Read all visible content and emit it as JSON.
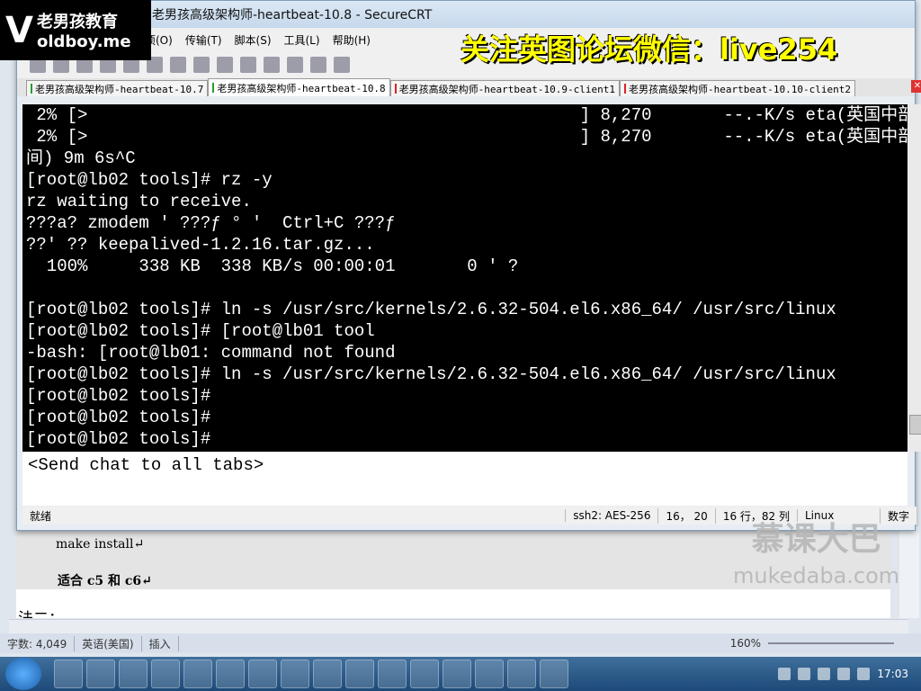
{
  "window_title": "老男孩高级架构师-heartbeat-10.8 - SecureCRT",
  "logo": {
    "cn": "老男孩教育",
    "en": "oldboy.me"
  },
  "watermark_top": "关注英图论坛微信：live254",
  "watermark_bottom": {
    "cn": "慕课大巴",
    "en": "mukedaba.com"
  },
  "menu": [
    "选项(O)",
    "传输(T)",
    "脚本(S)",
    "工具(L)",
    "帮助(H)"
  ],
  "tabs": [
    {
      "label": "老男孩高级架构师-heartbeat-10.7",
      "status_color": "#2a9d2a"
    },
    {
      "label": "老男孩高级架构师-heartbeat-10.8",
      "status_color": "#2a9d2a",
      "active": true
    },
    {
      "label": "老男孩高级架构师-heartbeat-10.9-client1",
      "status_color": "#d22"
    },
    {
      "label": "老男孩高级架构师-heartbeat-10.10-client2",
      "status_color": "#d22"
    }
  ],
  "terminal_lines": [
    " 2% [>                                                ] 8,270       --.-K/s eta(英国中部?",
    " 2% [>                                                ] 8,270       --.-K/s eta(英国中部?",
    "间) 9m 6s^C",
    "[root@lb02 tools]# rz -y",
    "rz waiting to receive.",
    "???a? zmodem ′ ???ƒ ° ′  Ctrl+C ???ƒ",
    "??′ ?? keepalived-1.2.16.tar.gz...",
    "  100%     338 KB  338 KB/s 00:00:01       0 ′ ?",
    "",
    "[root@lb02 tools]# ln -s /usr/src/kernels/2.6.32-504.el6.x86_64/ /usr/src/linux",
    "[root@lb02 tools]# [root@lb01 tool",
    "-bash: [root@lb01: command not found",
    "[root@lb02 tools]# ln -s /usr/src/kernels/2.6.32-504.el6.x86_64/ /usr/src/linux",
    "[root@lb02 tools]#",
    "[root@lb02 tools]#",
    "[root@lb02 tools]#"
  ],
  "chat_placeholder": "<Send chat to all tabs>",
  "crt_status": {
    "ready": "就绪",
    "cipher": "ssh2: AES-256",
    "cursor": "16， 20",
    "size": "16 行，82 列",
    "term": "Linux",
    "numlock": "数字"
  },
  "word": {
    "lines": [
      "make install↵",
      "适合 c5 和 c6↵",
      "法二："
    ],
    "status": {
      "words": "字数: 4,049",
      "lang": "英语(美国)",
      "mode": "插入",
      "zoom": "160%"
    }
  },
  "clock": "17:03"
}
